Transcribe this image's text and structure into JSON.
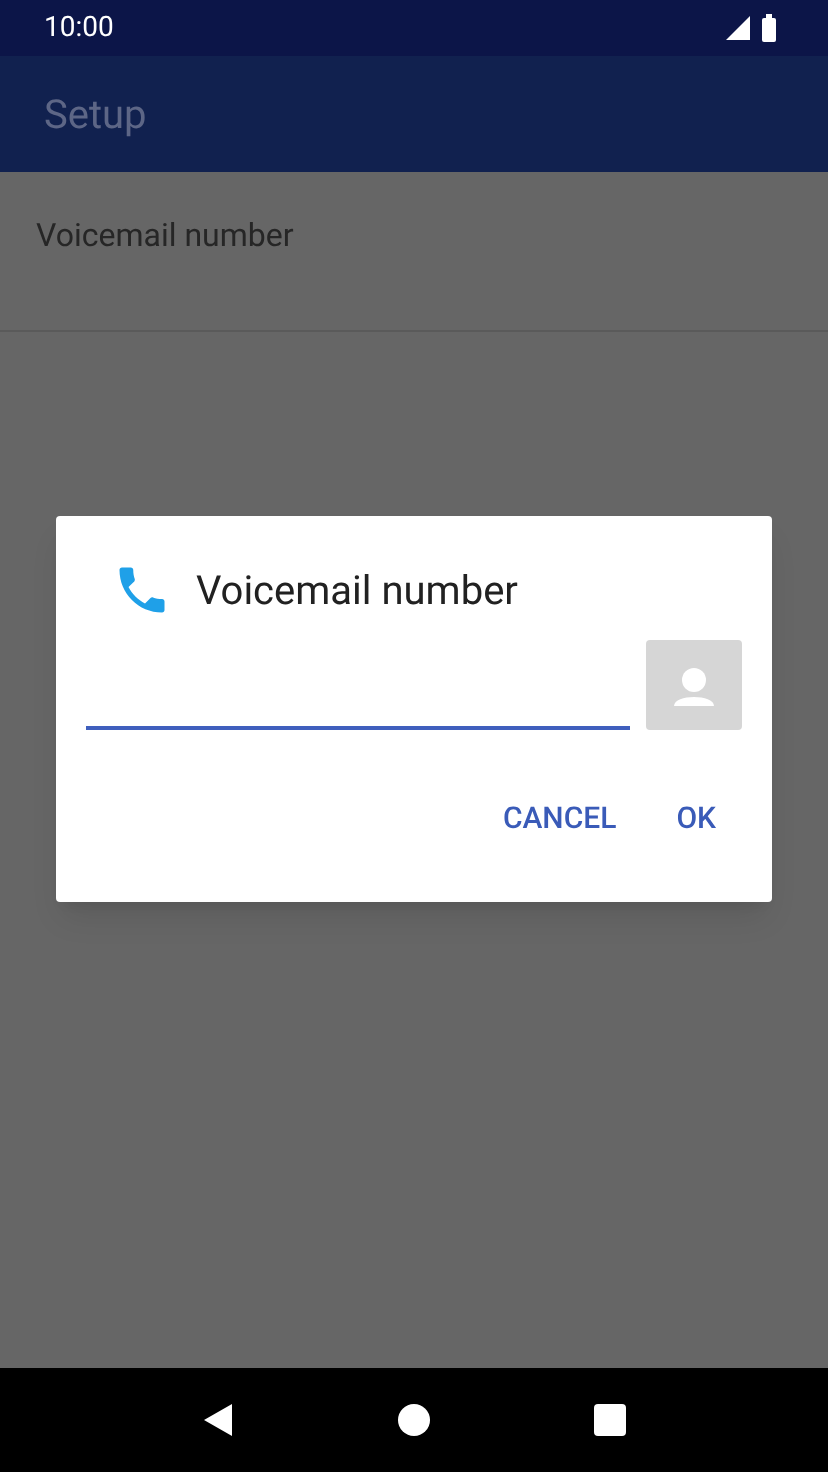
{
  "status_bar": {
    "time": "10:00"
  },
  "app_bar": {
    "title": "Setup"
  },
  "list": [
    {
      "label": "Voicemail number"
    }
  ],
  "dialog": {
    "title": "Voicemail number",
    "buttons": [
      "CANCEL",
      "OK"
    ]
  }
}
